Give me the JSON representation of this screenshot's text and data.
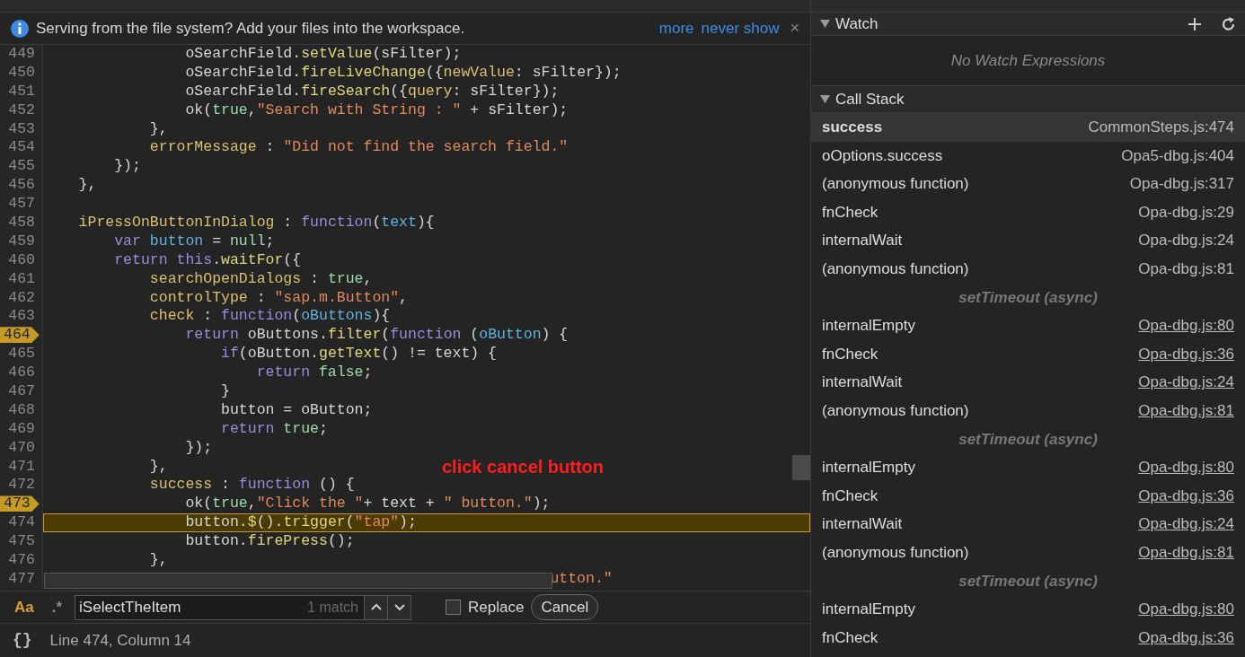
{
  "infobar": {
    "message": "Serving from the file system? Add your files into the workspace.",
    "links": [
      "more",
      "never show"
    ],
    "close": "×"
  },
  "editor": {
    "lines": [
      {
        "number": "449",
        "tokens": [
          {
            "kind": "plain",
            "text": "                oSearchField."
          },
          {
            "kind": "method",
            "text": "setValue"
          },
          {
            "kind": "plain",
            "text": "(sFilter);"
          }
        ]
      },
      {
        "number": "450",
        "tokens": [
          {
            "kind": "plain",
            "text": "                oSearchField."
          },
          {
            "kind": "method",
            "text": "fireLiveChange"
          },
          {
            "kind": "plain",
            "text": "({"
          },
          {
            "kind": "prop",
            "text": "newValue"
          },
          {
            "kind": "plain",
            "text": ": sFilter});"
          }
        ]
      },
      {
        "number": "451",
        "tokens": [
          {
            "kind": "plain",
            "text": "                oSearchField."
          },
          {
            "kind": "method",
            "text": "fireSearch"
          },
          {
            "kind": "plain",
            "text": "({"
          },
          {
            "kind": "prop",
            "text": "query"
          },
          {
            "kind": "plain",
            "text": ": sFilter});"
          }
        ]
      },
      {
        "number": "452",
        "tokens": [
          {
            "kind": "plain",
            "text": "                ok("
          },
          {
            "kind": "bool",
            "text": "true"
          },
          {
            "kind": "plain",
            "text": ","
          },
          {
            "kind": "string",
            "text": "\"Search with String : \""
          },
          {
            "kind": "plain",
            "text": " + sFilter);"
          }
        ]
      },
      {
        "number": "453",
        "tokens": [
          {
            "kind": "plain",
            "text": "            },"
          }
        ]
      },
      {
        "number": "454",
        "tokens": [
          {
            "kind": "prop",
            "text": "            errorMessage"
          },
          {
            "kind": "plain",
            "text": " : "
          },
          {
            "kind": "string",
            "text": "\"Did not find the search field.\""
          }
        ]
      },
      {
        "number": "455",
        "tokens": [
          {
            "kind": "plain",
            "text": "        });"
          }
        ]
      },
      {
        "number": "456",
        "tokens": [
          {
            "kind": "plain",
            "text": "    },"
          }
        ]
      },
      {
        "number": "457"
      },
      {
        "number": "458",
        "tokens": [
          {
            "kind": "prop",
            "text": "    iPressOnButtonInDialog"
          },
          {
            "kind": "plain",
            "text": " : "
          },
          {
            "kind": "keyword",
            "text": "function"
          },
          {
            "kind": "plain",
            "text": "("
          },
          {
            "kind": "param",
            "text": "text"
          },
          {
            "kind": "plain",
            "text": "){"
          }
        ]
      },
      {
        "number": "459",
        "tokens": [
          {
            "kind": "keyword",
            "text": "        var "
          },
          {
            "kind": "param",
            "text": "button"
          },
          {
            "kind": "plain",
            "text": " = "
          },
          {
            "kind": "bool",
            "text": "null"
          },
          {
            "kind": "plain",
            "text": ";"
          }
        ]
      },
      {
        "number": "460",
        "tokens": [
          {
            "kind": "keyword",
            "text": "        return this"
          },
          {
            "kind": "plain",
            "text": "."
          },
          {
            "kind": "method",
            "text": "waitFor"
          },
          {
            "kind": "plain",
            "text": "({"
          }
        ]
      },
      {
        "number": "461",
        "tokens": [
          {
            "kind": "prop",
            "text": "            searchOpenDialogs"
          },
          {
            "kind": "plain",
            "text": " : "
          },
          {
            "kind": "bool",
            "text": "true"
          },
          {
            "kind": "plain",
            "text": ","
          }
        ]
      },
      {
        "number": "462",
        "tokens": [
          {
            "kind": "prop",
            "text": "            controlType"
          },
          {
            "kind": "plain",
            "text": " : "
          },
          {
            "kind": "string",
            "text": "\"sap.m.Button\""
          },
          {
            "kind": "plain",
            "text": ","
          }
        ]
      },
      {
        "number": "463",
        "tokens": [
          {
            "kind": "prop",
            "text": "            check"
          },
          {
            "kind": "plain",
            "text": " : "
          },
          {
            "kind": "keyword",
            "text": "function"
          },
          {
            "kind": "plain",
            "text": "("
          },
          {
            "kind": "param",
            "text": "oButtons"
          },
          {
            "kind": "plain",
            "text": "){"
          }
        ]
      },
      {
        "number": "464",
        "breakpoint": true,
        "tokens": [
          {
            "kind": "keyword",
            "text": "                return"
          },
          {
            "kind": "plain",
            "text": " oButtons."
          },
          {
            "kind": "method",
            "text": "filter"
          },
          {
            "kind": "plain",
            "text": "("
          },
          {
            "kind": "keyword",
            "text": "function"
          },
          {
            "kind": "plain",
            "text": " ("
          },
          {
            "kind": "param",
            "text": "oButton"
          },
          {
            "kind": "plain",
            "text": ") {"
          }
        ]
      },
      {
        "number": "465",
        "tokens": [
          {
            "kind": "keyword",
            "text": "                    if"
          },
          {
            "kind": "plain",
            "text": "(oButton."
          },
          {
            "kind": "method",
            "text": "getText"
          },
          {
            "kind": "plain",
            "text": "() != text) {"
          }
        ]
      },
      {
        "number": "466",
        "tokens": [
          {
            "kind": "keyword",
            "text": "                        return "
          },
          {
            "kind": "bool",
            "text": "false"
          },
          {
            "kind": "plain",
            "text": ";"
          }
        ]
      },
      {
        "number": "467",
        "tokens": [
          {
            "kind": "plain",
            "text": "                    }"
          }
        ]
      },
      {
        "number": "468",
        "tokens": [
          {
            "kind": "plain",
            "text": "                    button = oButton;"
          }
        ]
      },
      {
        "number": "469",
        "tokens": [
          {
            "kind": "keyword",
            "text": "                    return "
          },
          {
            "kind": "bool",
            "text": "true"
          },
          {
            "kind": "plain",
            "text": ";"
          }
        ]
      },
      {
        "number": "470",
        "tokens": [
          {
            "kind": "plain",
            "text": "                });"
          }
        ]
      },
      {
        "number": "471",
        "tokens": [
          {
            "kind": "plain",
            "text": "            },"
          }
        ]
      },
      {
        "number": "472",
        "tokens": [
          {
            "kind": "prop",
            "text": "            success"
          },
          {
            "kind": "plain",
            "text": " : "
          },
          {
            "kind": "keyword",
            "text": "function"
          },
          {
            "kind": "plain",
            "text": " () {"
          }
        ]
      },
      {
        "number": "473",
        "breakpoint": true,
        "tokens": [
          {
            "kind": "plain",
            "text": "                ok("
          },
          {
            "kind": "bool",
            "text": "true"
          },
          {
            "kind": "plain",
            "text": ","
          },
          {
            "kind": "string",
            "text": "\"Click the \""
          },
          {
            "kind": "plain",
            "text": "+ text + "
          },
          {
            "kind": "string",
            "text": "\" button.\""
          },
          {
            "kind": "plain",
            "text": ");"
          }
        ]
      },
      {
        "number": "474",
        "current": true,
        "tokens": [
          {
            "kind": "plain",
            "text": "                button."
          },
          {
            "kind": "method",
            "text": "$"
          },
          {
            "kind": "plain",
            "text": "()."
          },
          {
            "kind": "method",
            "text": "trigger"
          },
          {
            "kind": "plain",
            "text": "("
          },
          {
            "kind": "string",
            "text": "\"tap\""
          },
          {
            "kind": "plain",
            "text": ");"
          }
        ]
      },
      {
        "number": "475",
        "tokens": [
          {
            "kind": "plain",
            "text": "                button."
          },
          {
            "kind": "method",
            "text": "firePress"
          },
          {
            "kind": "plain",
            "text": "();"
          }
        ]
      },
      {
        "number": "476",
        "tokens": [
          {
            "kind": "plain",
            "text": "            },"
          }
        ]
      },
      {
        "number": "477",
        "tokens": [
          {
            "kind": "string",
            "text": "                                                         utton.\""
          }
        ]
      }
    ],
    "annotation": "click cancel button"
  },
  "search": {
    "case_sensitive": true,
    "regex": false,
    "case_label": "Aa",
    "regex_label": ".*",
    "value": "iSelectTheItem",
    "match_count": "1 match",
    "replace_checked": false,
    "replace_label": "Replace",
    "cancel": "Cancel"
  },
  "status_bar": {
    "format_button": "{}",
    "position": "Line 474, Column 14"
  },
  "watch": {
    "title": "Watch",
    "expanded": true,
    "empty": "No Watch Expressions"
  },
  "call_stack": {
    "title": "Call Stack",
    "expanded": true,
    "frames": [
      {
        "kind": "frame",
        "name": "success",
        "location": "CommonSteps.js:474",
        "selected": true,
        "underlined": false
      },
      {
        "kind": "frame",
        "name": "oOptions.success",
        "location": "Opa5-dbg.js:404",
        "selected": false,
        "underlined": false
      },
      {
        "kind": "frame",
        "name": "(anonymous function)",
        "location": "Opa-dbg.js:317",
        "selected": false,
        "underlined": false
      },
      {
        "kind": "frame",
        "name": "fnCheck",
        "location": "Opa-dbg.js:29",
        "selected": false,
        "underlined": false
      },
      {
        "kind": "frame",
        "name": "internalWait",
        "location": "Opa-dbg.js:24",
        "selected": false,
        "underlined": false
      },
      {
        "kind": "frame",
        "name": "(anonymous function)",
        "location": "Opa-dbg.js:81",
        "selected": false,
        "underlined": false
      },
      {
        "kind": "async",
        "label": "setTimeout (async)"
      },
      {
        "kind": "frame",
        "name": "internalEmpty",
        "location": "Opa-dbg.js:80",
        "selected": false,
        "underlined": true
      },
      {
        "kind": "frame",
        "name": "fnCheck",
        "location": "Opa-dbg.js:36",
        "selected": false,
        "underlined": true
      },
      {
        "kind": "frame",
        "name": "internalWait",
        "location": "Opa-dbg.js:24",
        "selected": false,
        "underlined": true
      },
      {
        "kind": "frame",
        "name": "(anonymous function)",
        "location": "Opa-dbg.js:81",
        "selected": false,
        "underlined": true
      },
      {
        "kind": "async",
        "label": "setTimeout (async)"
      },
      {
        "kind": "frame",
        "name": "internalEmpty",
        "location": "Opa-dbg.js:80",
        "selected": false,
        "underlined": true
      },
      {
        "kind": "frame",
        "name": "fnCheck",
        "location": "Opa-dbg.js:36",
        "selected": false,
        "underlined": true
      },
      {
        "kind": "frame",
        "name": "internalWait",
        "location": "Opa-dbg.js:24",
        "selected": false,
        "underlined": true
      },
      {
        "kind": "frame",
        "name": "(anonymous function)",
        "location": "Opa-dbg.js:81",
        "selected": false,
        "underlined": true
      },
      {
        "kind": "async",
        "label": "setTimeout (async)"
      },
      {
        "kind": "frame",
        "name": "internalEmpty",
        "location": "Opa-dbg.js:80",
        "selected": false,
        "underlined": true
      },
      {
        "kind": "frame",
        "name": "fnCheck",
        "location": "Opa-dbg.js:36",
        "selected": false,
        "underlined": true
      }
    ]
  }
}
